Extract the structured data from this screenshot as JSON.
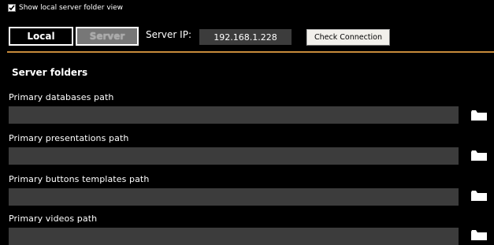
{
  "header": {
    "show_local_label": "Show local server folder view",
    "show_local_checked": true,
    "local_label": "Local",
    "server_label": "Server",
    "server_ip_label": "Server IP:",
    "server_ip_value": "192.168.1.228",
    "check_connection_label": "Check Connection"
  },
  "colors": {
    "accent": "#c78a3a",
    "field_bg": "#3c3c3c",
    "background": "#000000"
  },
  "server_folders": {
    "title": "Server folders",
    "paths": [
      {
        "label": "Primary databases path",
        "value": "",
        "icon": "folder-icon"
      },
      {
        "label": "Primary presentations path",
        "value": "",
        "icon": "folder-icon"
      },
      {
        "label": "Primary buttons templates path",
        "value": "",
        "icon": "folder-icon"
      },
      {
        "label": "Primary videos path",
        "value": "",
        "icon": "folder-icon"
      }
    ]
  }
}
